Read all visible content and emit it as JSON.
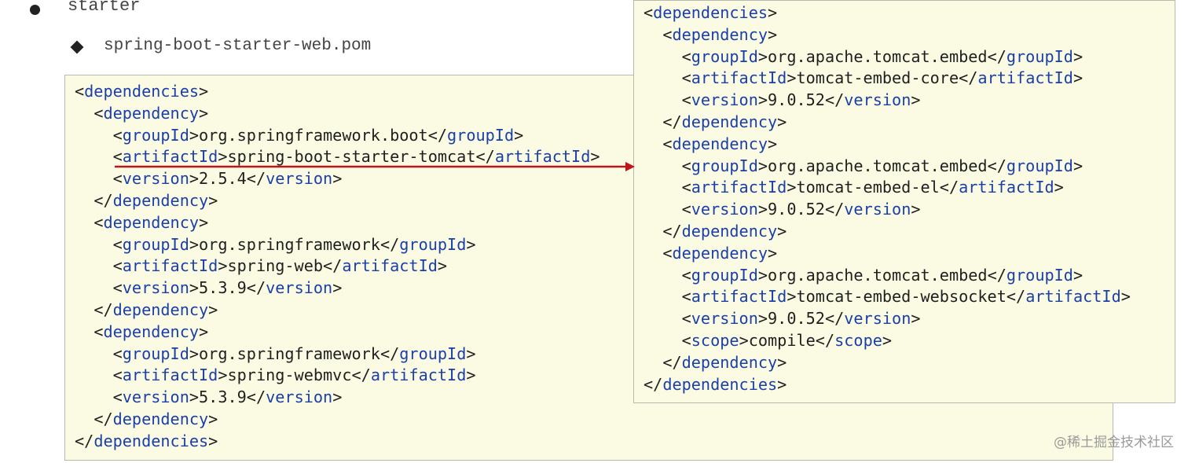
{
  "heading": "starter",
  "subheading": "spring-boot-starter-web.pom",
  "left_code": [
    {
      "indent": 0,
      "close": false,
      "tag": "dependencies"
    },
    {
      "indent": 1,
      "close": false,
      "tag": "dependency"
    },
    {
      "indent": 2,
      "tag": "groupId",
      "value": "org.springframework.boot"
    },
    {
      "indent": 2,
      "tag": "artifactId",
      "value": "spring-boot-starter-tomcat"
    },
    {
      "indent": 2,
      "tag": "version",
      "value": "2.5.4"
    },
    {
      "indent": 1,
      "close": true,
      "tag": "dependency"
    },
    {
      "indent": 1,
      "close": false,
      "tag": "dependency"
    },
    {
      "indent": 2,
      "tag": "groupId",
      "value": "org.springframework"
    },
    {
      "indent": 2,
      "tag": "artifactId",
      "value": "spring-web"
    },
    {
      "indent": 2,
      "tag": "version",
      "value": "5.3.9"
    },
    {
      "indent": 1,
      "close": true,
      "tag": "dependency"
    },
    {
      "indent": 1,
      "close": false,
      "tag": "dependency"
    },
    {
      "indent": 2,
      "tag": "groupId",
      "value": "org.springframework"
    },
    {
      "indent": 2,
      "tag": "artifactId",
      "value": "spring-webmvc"
    },
    {
      "indent": 2,
      "tag": "version",
      "value": "5.3.9"
    },
    {
      "indent": 1,
      "close": true,
      "tag": "dependency"
    },
    {
      "indent": 0,
      "close": true,
      "tag": "dependencies"
    }
  ],
  "right_code": [
    {
      "indent": 0,
      "close": false,
      "tag": "dependencies"
    },
    {
      "indent": 1,
      "close": false,
      "tag": "dependency"
    },
    {
      "indent": 2,
      "tag": "groupId",
      "value": "org.apache.tomcat.embed"
    },
    {
      "indent": 2,
      "tag": "artifactId",
      "value": "tomcat-embed-core"
    },
    {
      "indent": 2,
      "tag": "version",
      "value": "9.0.52"
    },
    {
      "indent": 1,
      "close": true,
      "tag": "dependency"
    },
    {
      "indent": 1,
      "close": false,
      "tag": "dependency"
    },
    {
      "indent": 2,
      "tag": "groupId",
      "value": "org.apache.tomcat.embed"
    },
    {
      "indent": 2,
      "tag": "artifactId",
      "value": "tomcat-embed-el"
    },
    {
      "indent": 2,
      "tag": "version",
      "value": "9.0.52"
    },
    {
      "indent": 1,
      "close": true,
      "tag": "dependency"
    },
    {
      "indent": 1,
      "close": false,
      "tag": "dependency"
    },
    {
      "indent": 2,
      "tag": "groupId",
      "value": "org.apache.tomcat.embed"
    },
    {
      "indent": 2,
      "tag": "artifactId",
      "value": "tomcat-embed-websocket"
    },
    {
      "indent": 2,
      "tag": "version",
      "value": "9.0.52"
    },
    {
      "indent": 2,
      "tag": "scope",
      "value": "compile"
    },
    {
      "indent": 1,
      "close": true,
      "tag": "dependency"
    },
    {
      "indent": 0,
      "close": true,
      "tag": "dependencies"
    }
  ],
  "colors": {
    "tag": "#1b3fa8",
    "text": "#1f1f1f",
    "box_background": "#fbfbe3",
    "box_border": "#b9b9ae",
    "arrow": "#c0141b"
  },
  "watermark": "@稀土掘金技术社区"
}
